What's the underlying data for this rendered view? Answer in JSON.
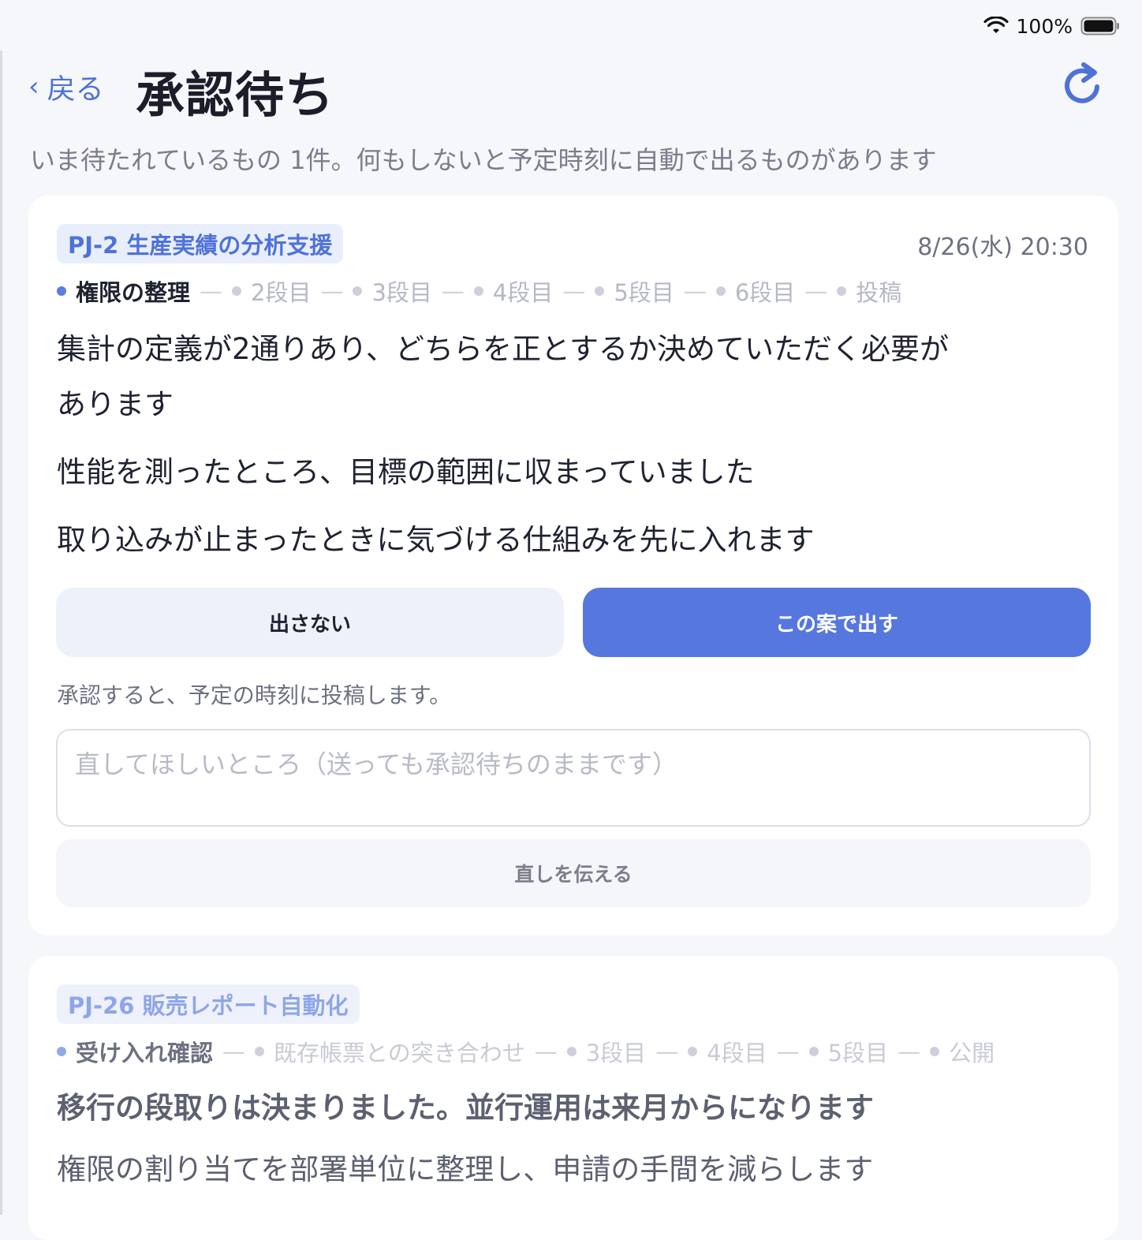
{
  "status_bar": {
    "battery": "100%",
    "icons": [
      "wifi-icon",
      "battery-icon"
    ]
  },
  "header": {
    "back_label": "戻る",
    "title": "承認待ち",
    "refresh_icon": "refresh-icon"
  },
  "subtitle": "いま待たれているもの 1件。何もしないと予定時刻に自動で出るものがあります",
  "cards": [
    {
      "tag": "PJ-2 生産実績の分析支援",
      "datetime": "8/26(水) 20:30",
      "steps": [
        "権限の整理",
        "2段目",
        "3段目",
        "4段目",
        "5段目",
        "6段目",
        "投稿"
      ],
      "active_step": 0,
      "lines": [
        "集計の定義が2通りあり、どちらを正とするか決めていただく必要が",
        "あります",
        "性能を測ったところ、目標の範囲に収まっていました",
        "取り込みが止まったときに気づける仕組みを先に入れます"
      ],
      "reject_label": "出さない",
      "approve_label": "この案で出す",
      "note": "承認すると、予定の時刻に投稿します。",
      "feedback_placeholder": "直してほしいところ（送っても承認待ちのままです）",
      "feedback_value": "",
      "send_fix_label": "直しを伝える"
    },
    {
      "tag": "PJ-26 販売レポート自動化",
      "steps": [
        "受け入れ確認",
        "既存帳票との突き合わせ",
        "3段目",
        "4段目",
        "5段目",
        "公開"
      ],
      "active_step": 0,
      "headline": "移行の段取りは決まりました。並行運用は来月からになります",
      "line": "権限の割り当てを部署単位に整理し、申請の手間を減らします"
    }
  ],
  "colors": {
    "accent": "#5677de",
    "background": "#f6f7fb",
    "card": "#ffffff",
    "muted_text": "#6e7180"
  }
}
